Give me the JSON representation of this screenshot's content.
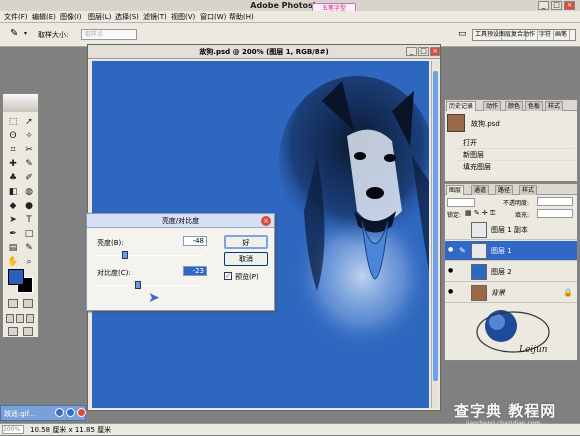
{
  "app": {
    "title": "Adobe Photoshop",
    "ime_badge": "五笔字型"
  },
  "menu": [
    "文件(F)",
    "编辑(E)",
    "图像(I)",
    "图层(L)",
    "选择(S)",
    "滤镜(T)",
    "视图(V)",
    "窗口(W)",
    "帮助(H)"
  ],
  "options_bar": {
    "sample_size_label": "取样大小:",
    "sample_size_value": "取样点",
    "palette_well_tabs": [
      "工具预设",
      "图层复合",
      "动作",
      "字符",
      "画笔"
    ]
  },
  "document": {
    "title": "故狗.psd @ 200% (图层 1, RGB/8#)",
    "canvas_color": "#2e67bf"
  },
  "dialog": {
    "title": "亮度/对比度",
    "brightness_label": "亮度(B):",
    "brightness_value": "-48",
    "brightness_level": -48,
    "contrast_label": "对比度(C):",
    "contrast_value": "-23",
    "contrast_level": -23,
    "ok_label": "好",
    "cancel_label": "取消",
    "preview_label": "预览(P)",
    "preview_checked": true
  },
  "history_panel": {
    "tabs": [
      "历史记录",
      "动作",
      "颜色",
      "色板",
      "样式"
    ],
    "snapshot_name": "故狗.psd",
    "items": [
      "打开",
      "新图层",
      "填充图层"
    ]
  },
  "layers_panel": {
    "tabs": [
      "图层",
      "通道",
      "路径",
      "样式"
    ],
    "opacity_label": "不透明度:",
    "lock_label": "锁定:",
    "fill_label": "填充:",
    "layers": [
      {
        "name": "图层 1 副本",
        "thumb_color": "#e8e8e8",
        "selected": false,
        "visible": false
      },
      {
        "name": "图层 1",
        "thumb_color": "#e8e8e8",
        "selected": true,
        "visible": true
      },
      {
        "name": "图层 2",
        "thumb_color": "#2e67bf",
        "selected": false,
        "visible": true
      },
      {
        "name": "背景",
        "thumb_color": "#9a6a48",
        "selected": false,
        "visible": true
      }
    ],
    "logo_text": "Leijun"
  },
  "minimized_window": {
    "title": "故适.gif..."
  },
  "status_bar": {
    "zoom": "200%",
    "doc_size": "10.58 厘米 x 11.85 厘米"
  },
  "watermark": {
    "text": "查字典 教程网",
    "url": "jiaocheng.chazidian.com"
  },
  "colors": {
    "foreground": "#2d5ebe",
    "background": "#000000",
    "selection": "#3168c8"
  }
}
